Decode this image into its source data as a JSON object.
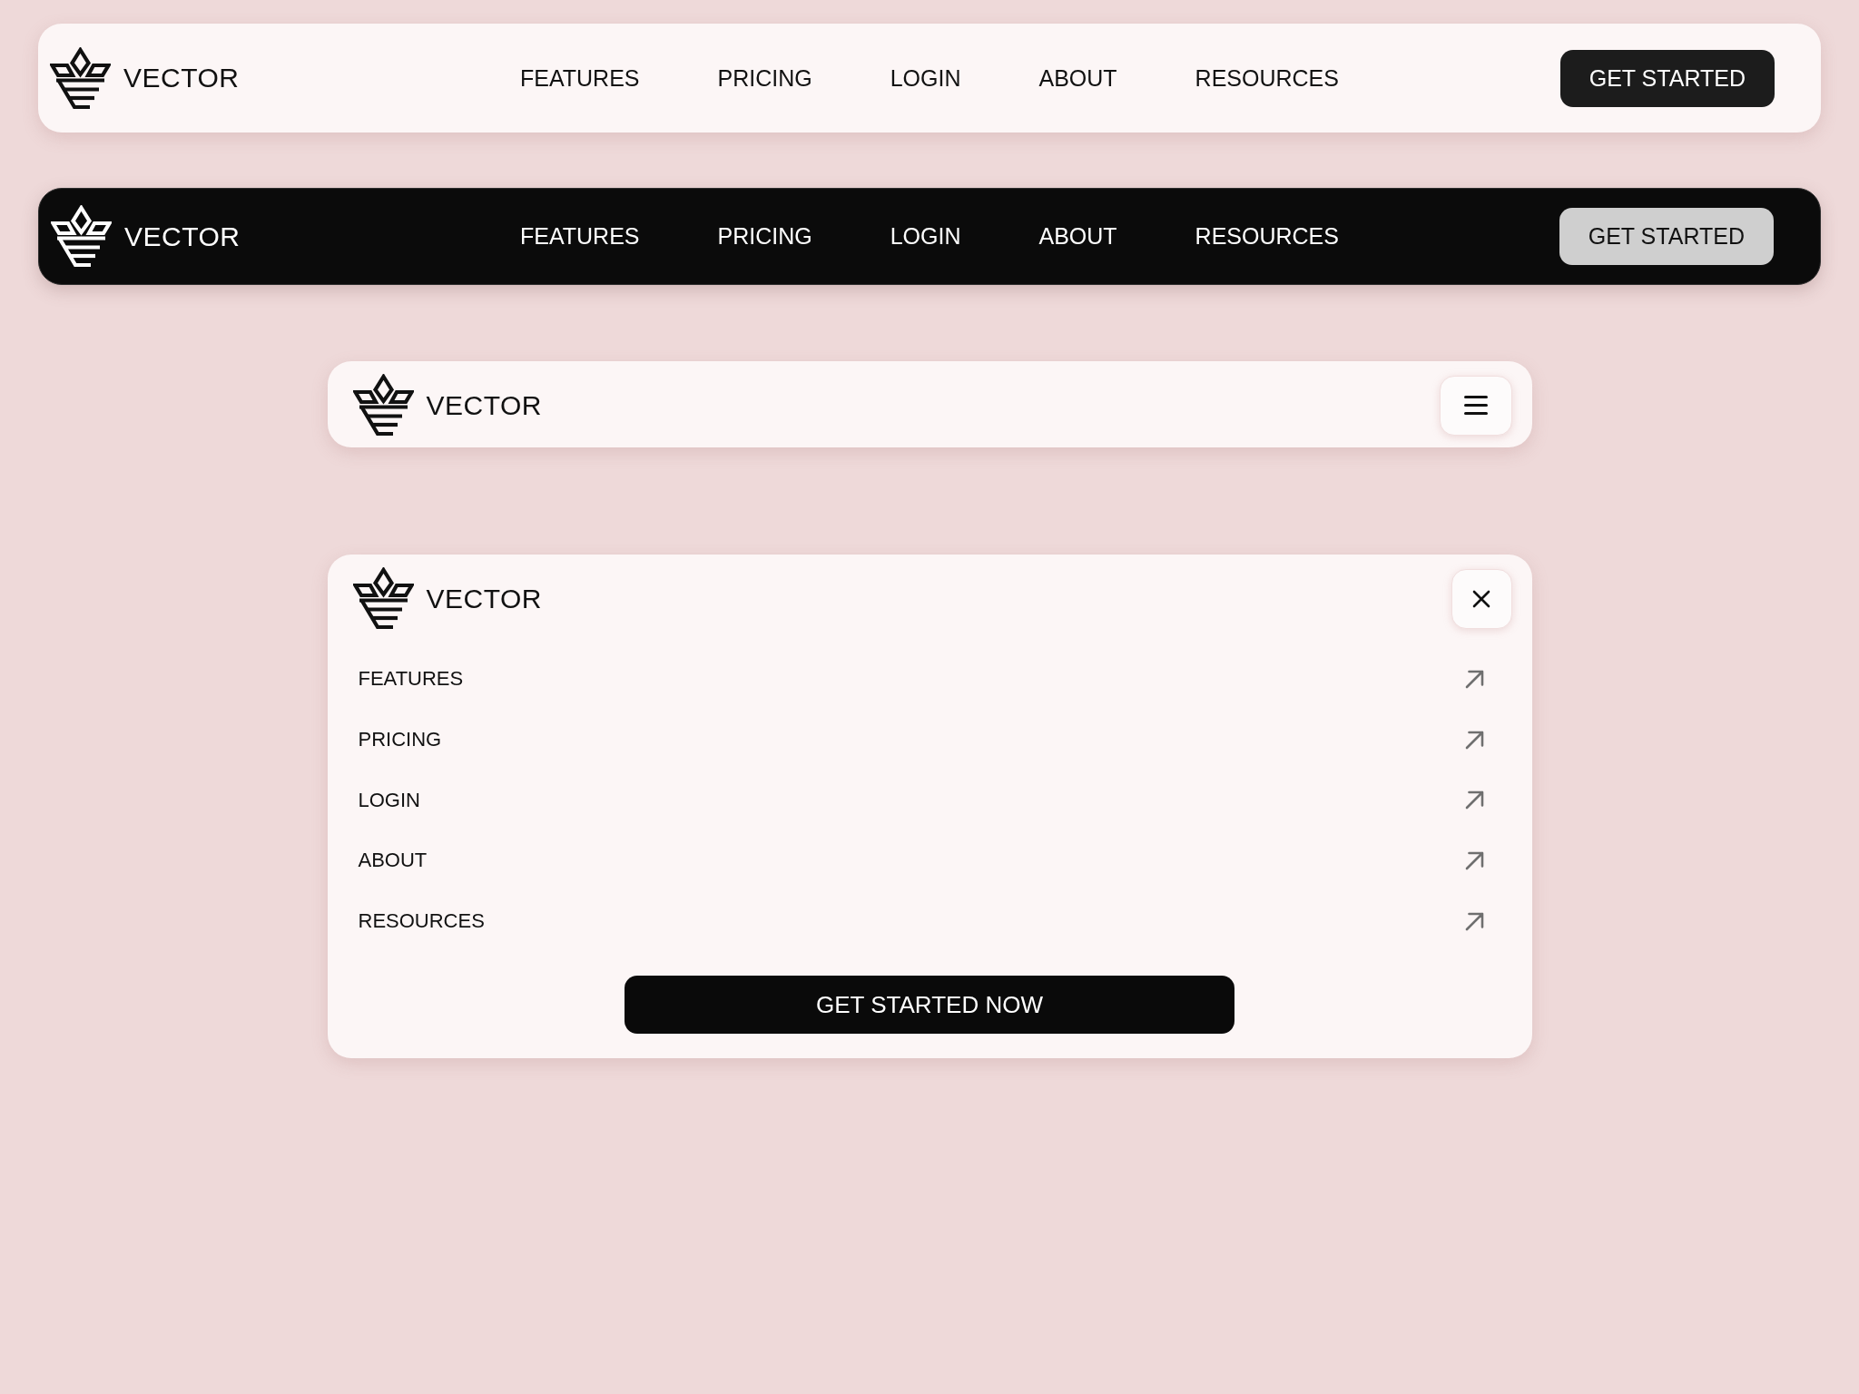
{
  "navbars": [
    {
      "kind": "desktop",
      "dark": false,
      "brand": "VECTOR",
      "links": [
        "FEATURES",
        "PRICING",
        "LOGIN",
        "ABOUT",
        "RESOURCES"
      ],
      "cta": "GET STARTED"
    },
    {
      "kind": "desktop",
      "dark": true,
      "brand": "VECTOR",
      "links": [
        "FEATURES",
        "PRICING",
        "LOGIN",
        "ABOUT",
        "RESOURCES"
      ],
      "cta": "GET STARTED"
    },
    {
      "kind": "mobile",
      "expanded": false,
      "brand": "VECTOR"
    },
    {
      "kind": "mobile",
      "expanded": true,
      "brand": "VECTOR",
      "links": [
        "FEATURES",
        "PRICING",
        "LOGIN",
        "ABOUT",
        "RESOURCES"
      ],
      "cta": "GET STARTED NOW"
    }
  ]
}
